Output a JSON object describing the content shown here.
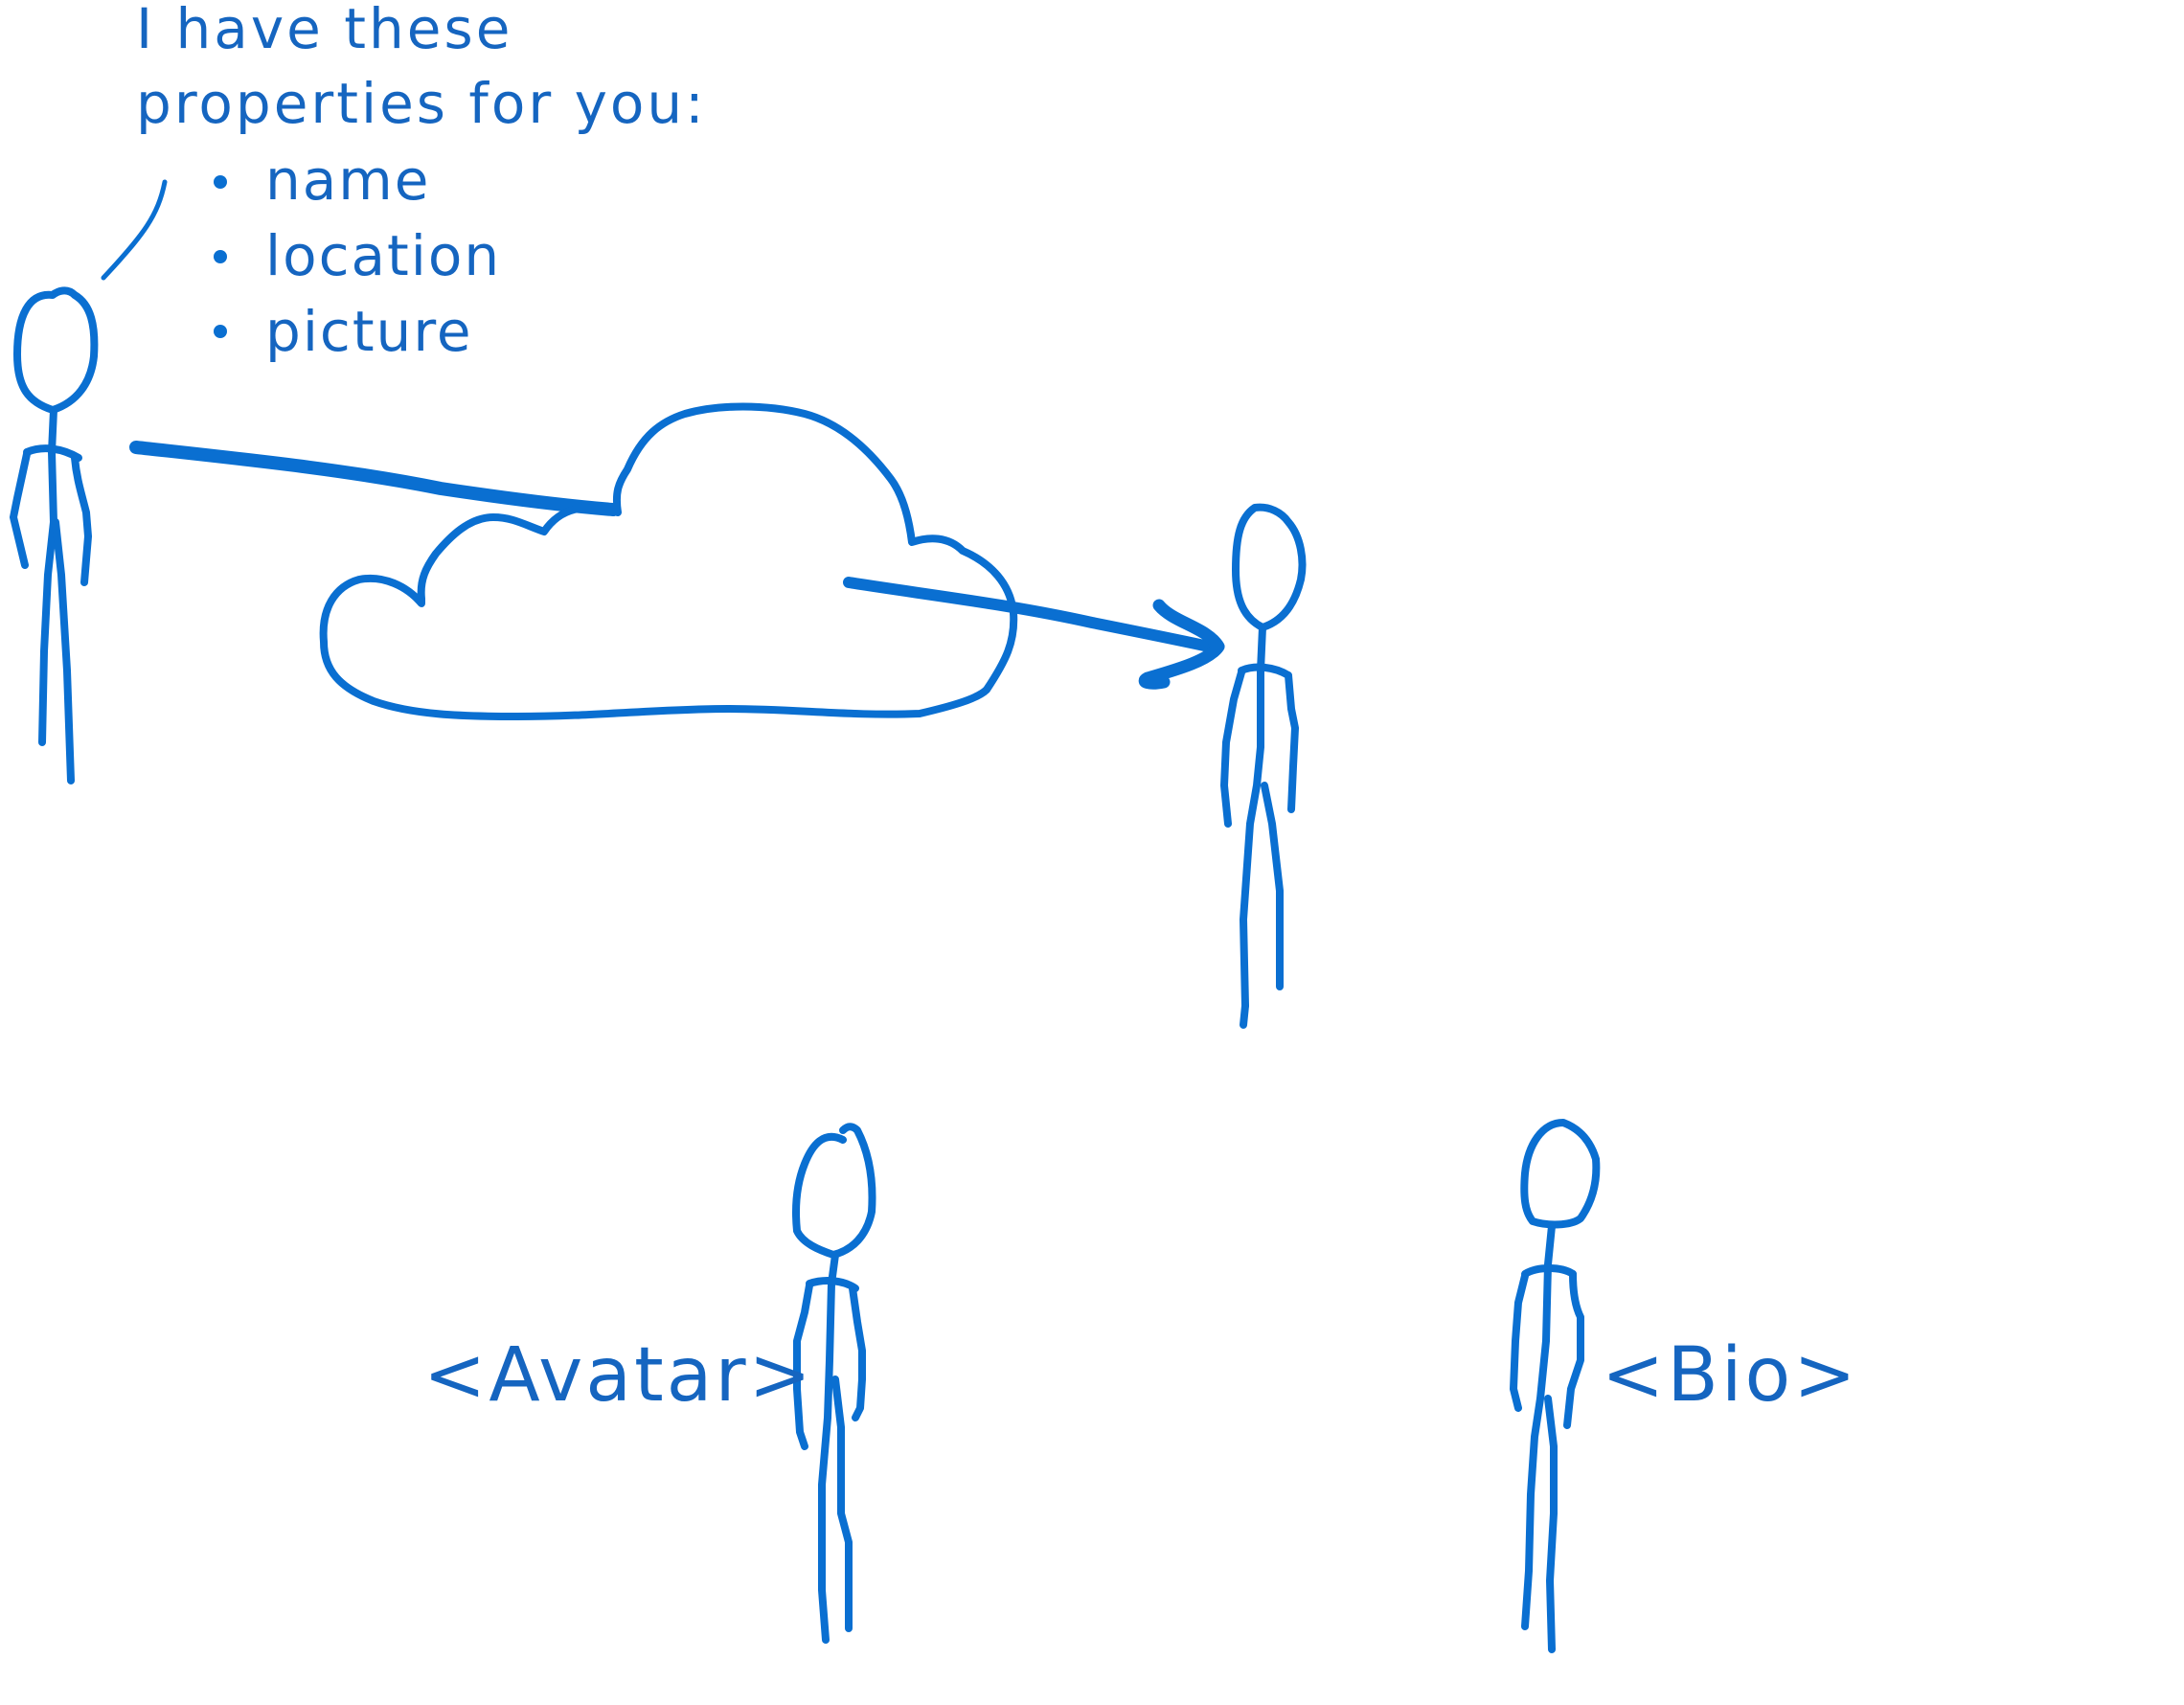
{
  "speech": {
    "line1": "I have these",
    "line2": "properties for you:",
    "bullets": [
      "name",
      "location",
      "picture"
    ]
  },
  "labels": {
    "avatar": "<Avatar>",
    "bio": "<Bio>"
  },
  "colors": {
    "ink": "#0a6fd1",
    "text": "#1565c0"
  }
}
